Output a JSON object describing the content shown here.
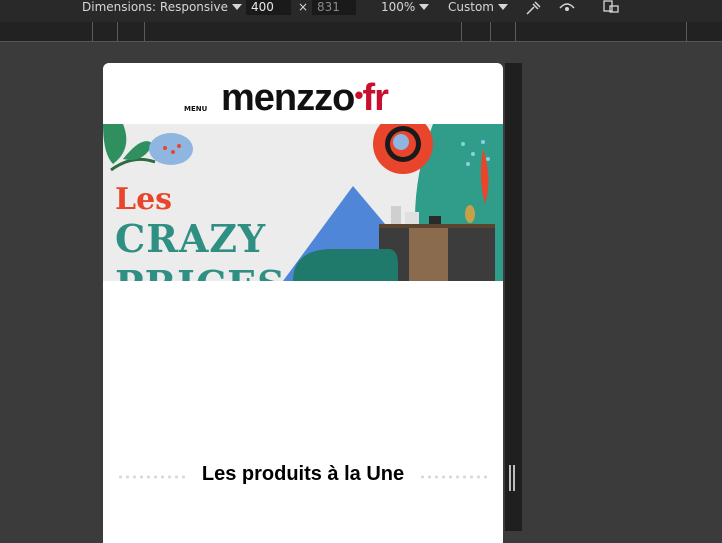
{
  "devtools": {
    "dimensions_label": "Dimensions: Responsive",
    "width_value": "400",
    "separator": "×",
    "height_value": "831",
    "zoom": "100%",
    "throttle": "Custom"
  },
  "site": {
    "menu_label": "MENU",
    "logo_main": "menzzo",
    "logo_dot": "•",
    "logo_tld": "fr"
  },
  "hero": {
    "line1": "Les",
    "line2": "CRAZY",
    "line3": "PRICES",
    "colors": {
      "line1": "#e8452c",
      "line2": "#2f8f82"
    }
  },
  "section": {
    "title": "Les produits à la Une"
  }
}
